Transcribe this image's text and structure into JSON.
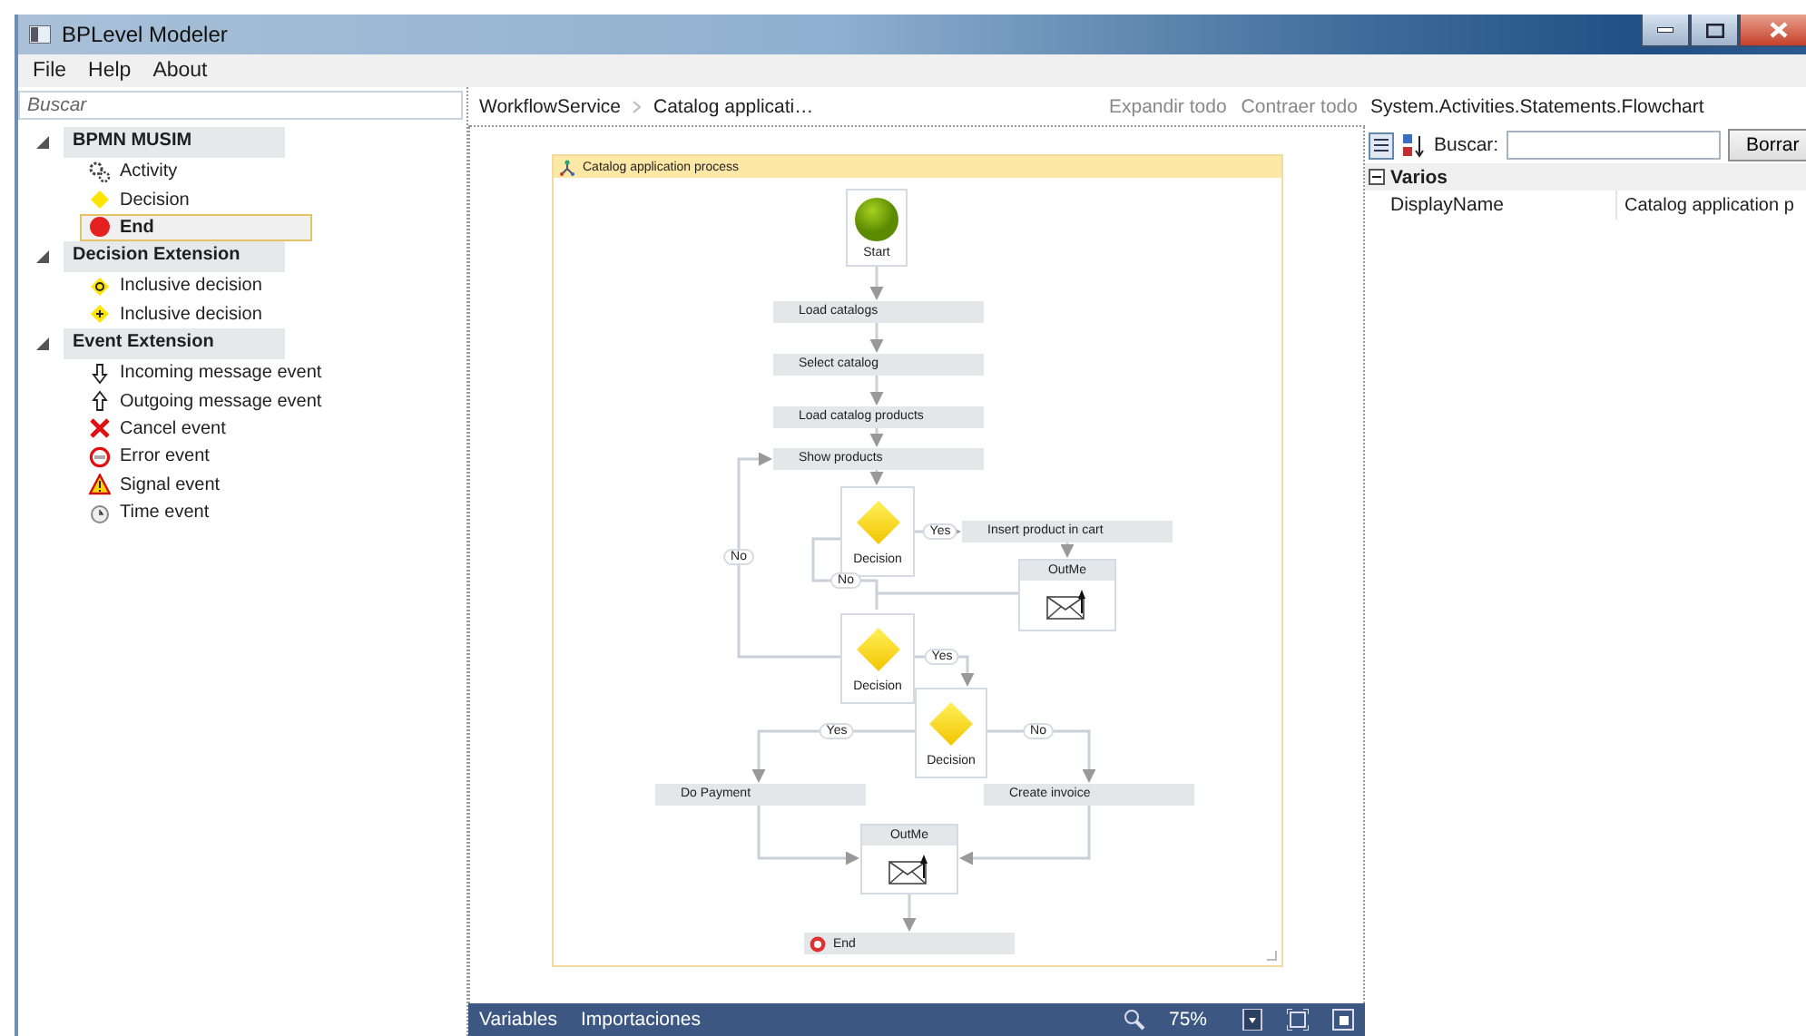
{
  "window": {
    "title": "BPLevel Modeler"
  },
  "menu": [
    "File",
    "Help",
    "About"
  ],
  "toolbox": {
    "search": {
      "placeholder": "Buscar"
    },
    "groups": [
      {
        "label": "BPMN MUSIM",
        "expanded": true,
        "items": [
          {
            "kind": "activity",
            "label": "Activity",
            "selected": false
          },
          {
            "kind": "decision",
            "label": "Decision",
            "selected": false
          },
          {
            "kind": "end",
            "label": "End",
            "selected": true
          }
        ]
      },
      {
        "label": "Decision Extension",
        "expanded": true,
        "items": [
          {
            "kind": "inclusive-circle",
            "label": "Inclusive decision",
            "selected": false
          },
          {
            "kind": "inclusive-plus",
            "label": "Inclusive decision",
            "selected": false
          }
        ]
      },
      {
        "label": "Event Extension",
        "expanded": true,
        "items": [
          {
            "kind": "incoming",
            "label": "Incoming message event",
            "selected": false
          },
          {
            "kind": "outgoing",
            "label": "Outgoing message event",
            "selected": false
          },
          {
            "kind": "cancel",
            "label": "Cancel event",
            "selected": false
          },
          {
            "kind": "error",
            "label": "Error event",
            "selected": false
          },
          {
            "kind": "signal",
            "label": "Signal event",
            "selected": false
          },
          {
            "kind": "time",
            "label": "Time event",
            "selected": false
          }
        ]
      }
    ]
  },
  "designer": {
    "breadcrumb": [
      "WorkflowService",
      "Catalog applicati…"
    ],
    "actions": [
      "Expandir todo",
      "Contraer todo"
    ],
    "flowchart": {
      "title": "Catalog application process",
      "nodes": [
        {
          "kind": "start",
          "label": "Start"
        },
        {
          "kind": "activity",
          "label": "Load catalogs"
        },
        {
          "kind": "activity",
          "label": "Select catalog"
        },
        {
          "kind": "activity",
          "label": "Load catalog products"
        },
        {
          "kind": "activity",
          "label": "Show products"
        },
        {
          "kind": "decision",
          "label": "Decision"
        },
        {
          "kind": "activity",
          "label": "Insert product in cart"
        },
        {
          "kind": "message",
          "label": "OutMe"
        },
        {
          "kind": "decision",
          "label": "Decision"
        },
        {
          "kind": "decision",
          "label": "Decision"
        },
        {
          "kind": "activity",
          "label": "Do Payment"
        },
        {
          "kind": "activity",
          "label": "Create invoice"
        },
        {
          "kind": "message",
          "label": "OutMe"
        },
        {
          "kind": "end",
          "label": "End"
        }
      ],
      "edge_labels": [
        "Yes",
        "No",
        "No",
        "Yes",
        "Yes",
        "No"
      ]
    },
    "bottom_tabs": [
      "Variables",
      "Importaciones"
    ],
    "zoom": "75%"
  },
  "properties": {
    "type": "System.Activities.Statements.Flowchart",
    "search_label": "Buscar:",
    "clear_button": "Borrar",
    "categories": [
      {
        "label": "Varios",
        "expanded": true,
        "rows": [
          {
            "name": "DisplayName",
            "value": "Catalog application p"
          }
        ]
      }
    ]
  }
}
